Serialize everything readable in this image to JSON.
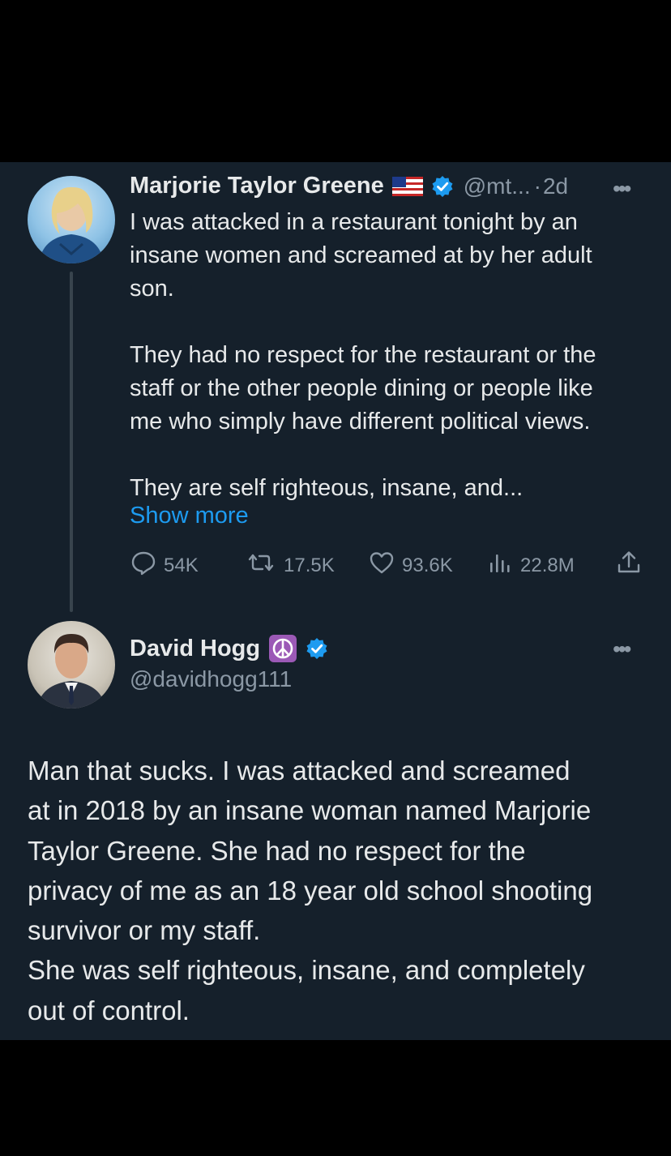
{
  "tweet": {
    "author_name": "Marjorie Taylor Greene",
    "flag_icon": "us-flag-icon",
    "verified_icon": "verified-badge-icon",
    "handle": "@mt...",
    "separator": "·",
    "time": "2d",
    "more_icon": "more-horizontal-icon",
    "text": "I was attacked in a restaurant tonight by an\ninsane women and screamed at by her adult\nson.\n\nThey had no respect for the restaurant or the\nstaff or the other people dining or people like\nme who simply have different political views.\n\nThey are self righteous, insane, and...",
    "show_more": "Show more",
    "actions": {
      "replies": "54K",
      "retweets": "17.5K",
      "likes": "93.6K",
      "views": "22.8M"
    }
  },
  "reply": {
    "author_name": "David Hogg",
    "peace_icon": "peace-symbol-icon",
    "verified_icon": "verified-badge-icon",
    "handle": "@davidhogg111",
    "more_icon": "more-horizontal-icon",
    "text": "Man that sucks. I was attacked and screamed\nat in 2018 by an insane woman named Marjorie\nTaylor Greene. She had no respect for the\nprivacy of me as an 18 year old school shooting\nsurvivor or my staff.\nShe was self righteous, insane, and completely\nout of control."
  },
  "colors": {
    "background": "#000000",
    "panel": "#15202b",
    "text_primary": "#e7e9ea",
    "text_secondary": "#8b98a5",
    "accent": "#1d9bf0",
    "peace_purple": "#9b59b6"
  }
}
